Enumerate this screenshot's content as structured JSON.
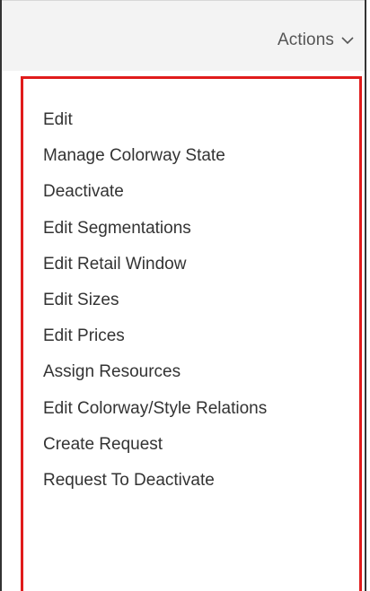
{
  "header": {
    "actions_label": "Actions",
    "actions_icon": "chevron-down-icon"
  },
  "menu": {
    "highlight_color": "#e01b1b",
    "items": [
      {
        "label": "Edit"
      },
      {
        "label": "Manage Colorway State"
      },
      {
        "label": "Deactivate"
      },
      {
        "label": "Edit Segmentations"
      },
      {
        "label": "Edit Retail Window"
      },
      {
        "label": "Edit Sizes"
      },
      {
        "label": "Edit Prices"
      },
      {
        "label": "Assign Resources"
      },
      {
        "label": "Edit Colorway/Style Relations"
      },
      {
        "label": "Create Request"
      },
      {
        "label": "Request To Deactivate"
      }
    ]
  }
}
